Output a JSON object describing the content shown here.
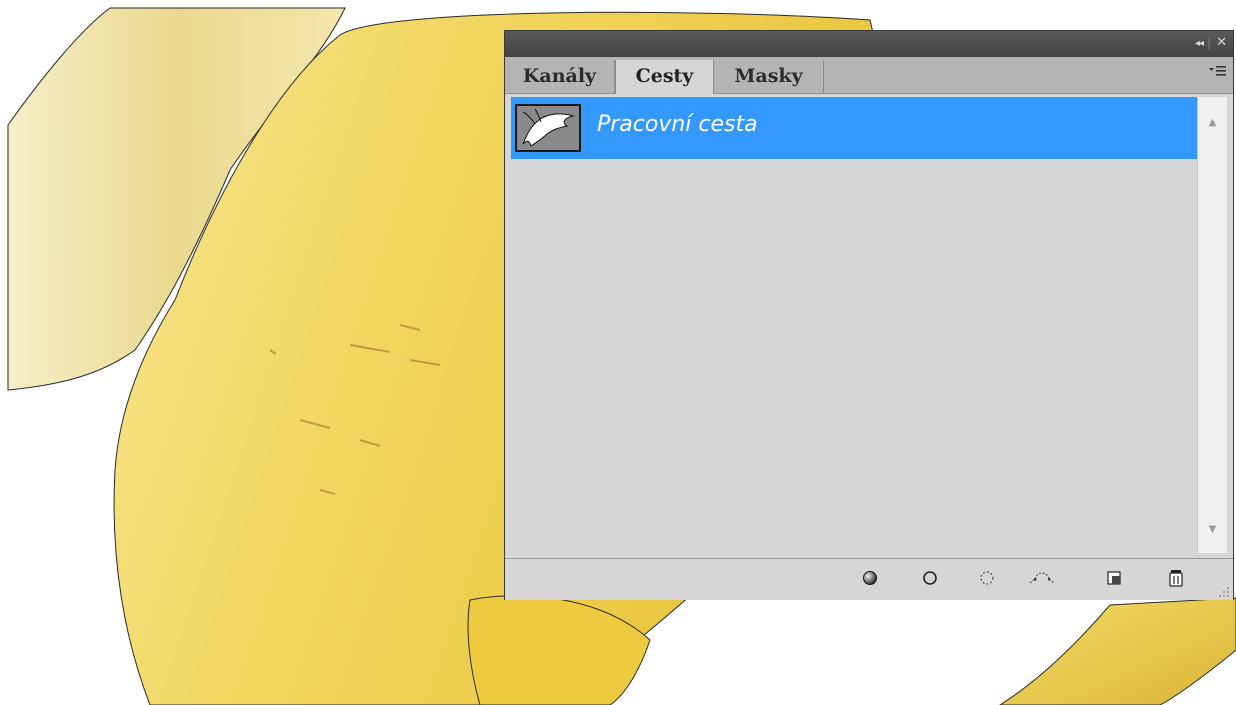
{
  "panel": {
    "title_buttons": {
      "collapse": "◂◂",
      "separator": "|",
      "close": "✕"
    },
    "tabs": [
      {
        "label": "Kanály",
        "active": false
      },
      {
        "label": "Cesty",
        "active": true
      },
      {
        "label": "Masky",
        "active": false
      }
    ],
    "menu_icon": "panel-menu-icon",
    "paths": [
      {
        "name": "Pracovní cesta",
        "selected": true,
        "thumbnail": "path-thumbnail"
      }
    ],
    "footer_buttons": [
      "fill-path-icon",
      "stroke-path-icon",
      "load-path-as-selection-icon",
      "make-work-path-icon",
      "new-path-icon",
      "delete-path-icon"
    ]
  },
  "colors": {
    "selection": "#3399ff",
    "panel_bg": "#d6d6d6",
    "titlebar": "#4a4a4a",
    "banana": "#f3dc6a"
  }
}
